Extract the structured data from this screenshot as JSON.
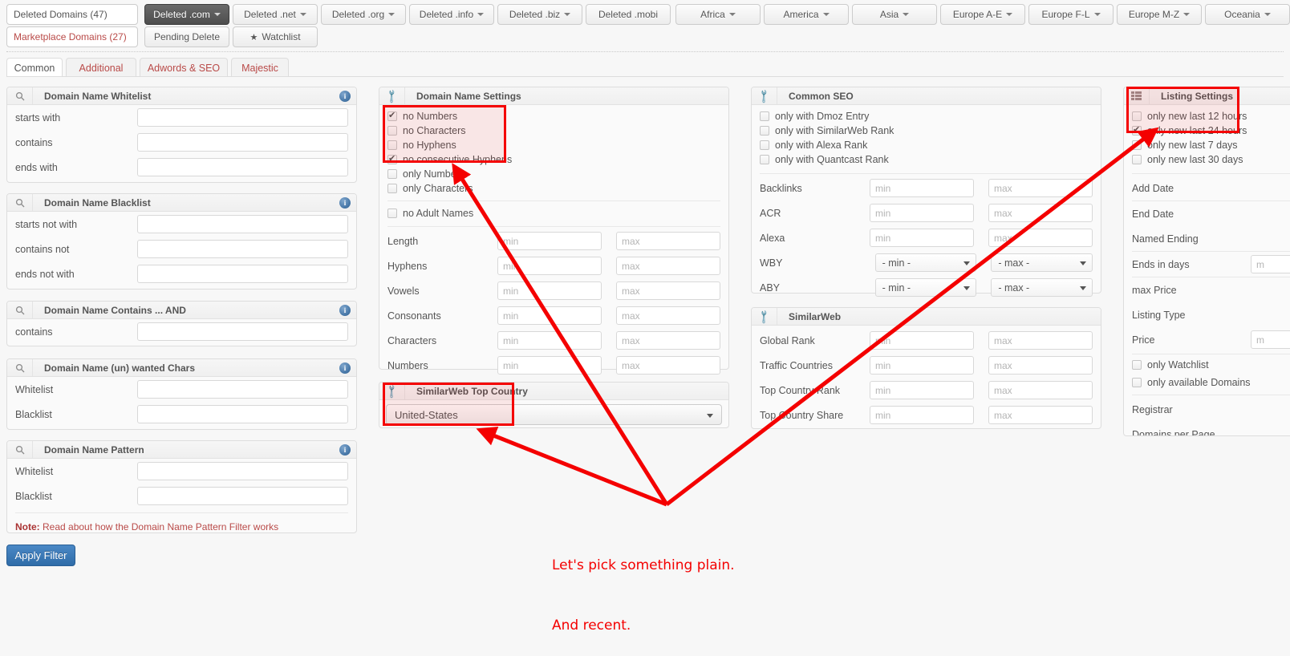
{
  "topbar": {
    "left_stack": [
      {
        "label": "Deleted Domains (47)",
        "style": "plain"
      },
      {
        "label": "Marketplace Domains (27)",
        "style": "red"
      }
    ],
    "row1": [
      {
        "label": "Deleted .com",
        "caret": true,
        "active": true
      },
      {
        "label": "Deleted .net",
        "caret": true
      },
      {
        "label": "Deleted .org",
        "caret": true
      },
      {
        "label": "Deleted .info",
        "caret": true
      },
      {
        "label": "Deleted .biz",
        "caret": true
      },
      {
        "label": "Deleted .mobi",
        "caret": false
      },
      {
        "label": "Africa",
        "caret": true
      },
      {
        "label": "America",
        "caret": true
      },
      {
        "label": "Asia",
        "caret": true
      },
      {
        "label": "Europe A-E",
        "caret": true
      },
      {
        "label": "Europe F-L",
        "caret": true
      },
      {
        "label": "Europe M-Z",
        "caret": true
      },
      {
        "label": "Oceania",
        "caret": true
      }
    ],
    "row2": [
      {
        "label": "Pending Delete",
        "star": false
      },
      {
        "label": "Watchlist",
        "star": true
      }
    ]
  },
  "subtabs": [
    {
      "label": "Common",
      "selected": true
    },
    {
      "label": "Additional",
      "selected": false
    },
    {
      "label": "Adwords & SEO",
      "selected": false
    },
    {
      "label": "Majestic",
      "selected": false
    }
  ],
  "panels": {
    "whitelist": {
      "icon": "search-icon",
      "title": "Domain Name Whitelist",
      "info": "i",
      "rows": [
        {
          "label": "starts with",
          "value": "",
          "placeholder": ""
        },
        {
          "label": "contains",
          "value": "",
          "placeholder": ""
        },
        {
          "label": "ends with",
          "value": "",
          "placeholder": ""
        }
      ]
    },
    "blacklist": {
      "icon": "search-icon",
      "title": "Domain Name Blacklist",
      "info": "i",
      "rows": [
        {
          "label": "starts not with",
          "value": "",
          "placeholder": ""
        },
        {
          "label": "contains not",
          "value": "",
          "placeholder": ""
        },
        {
          "label": "ends not with",
          "value": "",
          "placeholder": ""
        }
      ]
    },
    "contains_and": {
      "icon": "search-icon",
      "title": "Domain Name Contains ... AND",
      "info": "i",
      "rows": [
        {
          "label": "contains",
          "value": "",
          "placeholder": ""
        }
      ]
    },
    "wanted_chars": {
      "icon": "search-icon",
      "title": "Domain Name (un) wanted Chars",
      "info": "i",
      "rows": [
        {
          "label": "Whitelist",
          "value": "",
          "placeholder": ""
        },
        {
          "label": "Blacklist",
          "value": "",
          "placeholder": ""
        }
      ]
    },
    "pattern": {
      "icon": "search-icon",
      "title": "Domain Name Pattern",
      "info": "i",
      "rows": [
        {
          "label": "Whitelist",
          "value": "",
          "placeholder": ""
        },
        {
          "label": "Blacklist",
          "value": "",
          "placeholder": ""
        }
      ],
      "note_prefix": "Note:",
      "note_text": " Read about how the Domain Name Pattern Filter works"
    },
    "domain_settings": {
      "icon": "wrench-icon",
      "title": "Domain Name Settings",
      "checkboxes": [
        {
          "label": "no Numbers",
          "checked": true,
          "highlighted": true
        },
        {
          "label": "no Characters",
          "checked": false,
          "highlighted": true
        },
        {
          "label": "no Hyphens",
          "checked": false,
          "highlighted": true
        },
        {
          "label": "no consecutive Hyphens",
          "checked": true,
          "highlighted": true
        },
        {
          "label": "only Numbers",
          "checked": false,
          "highlighted": false
        },
        {
          "label": "only Characters",
          "checked": false,
          "highlighted": false
        }
      ],
      "checkboxes2": [
        {
          "label": "no Adult Names",
          "checked": false
        }
      ],
      "ranges": [
        {
          "label": "Length",
          "min": "min",
          "max": "max"
        },
        {
          "label": "Hyphens",
          "min": "min",
          "max": "max"
        },
        {
          "label": "Vowels",
          "min": "min",
          "max": "max"
        },
        {
          "label": "Consonants",
          "min": "min",
          "max": "max"
        },
        {
          "label": "Characters",
          "min": "min",
          "max": "max"
        },
        {
          "label": "Numbers",
          "min": "min",
          "max": "max"
        }
      ]
    },
    "top_country": {
      "icon": "wrench-icon",
      "title": "SimilarWeb Top Country",
      "selected": "United-States"
    },
    "common_seo": {
      "icon": "wrench-icon",
      "title": "Common SEO",
      "checkboxes": [
        {
          "label": "only with Dmoz Entry",
          "checked": false
        },
        {
          "label": "only with SimilarWeb Rank",
          "checked": false
        },
        {
          "label": "only with Alexa Rank",
          "checked": false
        },
        {
          "label": "only with Quantcast Rank",
          "checked": false
        }
      ],
      "ranges": [
        {
          "label": "Backlinks",
          "min": "min",
          "max": "max",
          "kind": "input"
        },
        {
          "label": "ACR",
          "min": "min",
          "max": "max",
          "kind": "input"
        },
        {
          "label": "Alexa",
          "min": "min",
          "max": "max",
          "kind": "input"
        },
        {
          "label": "WBY",
          "min": "- min -",
          "max": "- max -",
          "kind": "select"
        },
        {
          "label": "ABY",
          "min": "- min -",
          "max": "- max -",
          "kind": "select"
        }
      ]
    },
    "similarweb": {
      "icon": "wrench-icon",
      "title": "SimilarWeb",
      "ranges": [
        {
          "label": "Global Rank",
          "min": "min",
          "max": "max"
        },
        {
          "label": "Traffic Countries",
          "min": "min",
          "max": "max"
        },
        {
          "label": "Top Country Rank",
          "min": "min",
          "max": "max"
        },
        {
          "label": "Top Country Share",
          "min": "min",
          "max": "max"
        }
      ]
    },
    "listing_settings": {
      "icon": "list-icon",
      "title": "Listing Settings",
      "checkboxes_top": [
        {
          "label": "only new last 12 hours",
          "checked": false,
          "highlighted": true
        },
        {
          "label": "only new last 24 hours",
          "checked": true,
          "highlighted": true
        },
        {
          "label": "only new last 7 days",
          "checked": false,
          "highlighted": false
        },
        {
          "label": "only new last 30 days",
          "checked": false,
          "highlighted": false
        }
      ],
      "fields": [
        {
          "label": "Add Date",
          "kind": "label"
        },
        {
          "label": "End Date",
          "kind": "label"
        },
        {
          "label": "Named Ending",
          "kind": "label"
        },
        {
          "label": "Ends in days",
          "kind": "range",
          "min": "m"
        },
        {
          "label": "max Price",
          "kind": "label"
        },
        {
          "label": "Listing Type",
          "kind": "label"
        },
        {
          "label": "Price",
          "kind": "range",
          "min": "m"
        }
      ],
      "checkboxes_bottom": [
        {
          "label": "only Watchlist",
          "checked": false
        },
        {
          "label": "only available Domains",
          "checked": false
        }
      ],
      "fields_bottom": [
        {
          "label": "Registrar",
          "kind": "label"
        },
        {
          "label": "Domains per Page",
          "kind": "label"
        }
      ]
    }
  },
  "apply_button": {
    "label": "Apply Filter"
  },
  "annotation": {
    "color": "#f40000",
    "line1": "Let's pick something plain.",
    "line2": "And recent."
  }
}
